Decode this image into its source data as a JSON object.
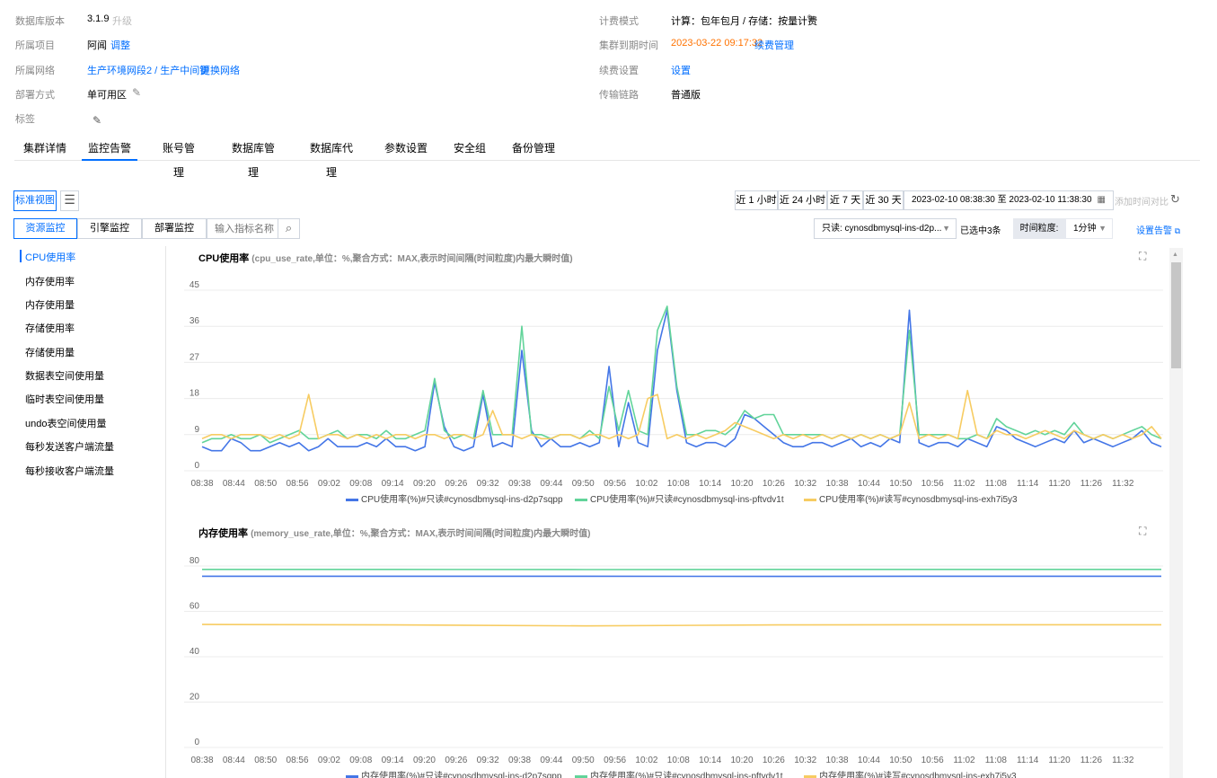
{
  "info": {
    "left": [
      {
        "label": "数据库版本",
        "value": "3.1.9",
        "action": "升级"
      },
      {
        "label": "所属项目",
        "value": "阿闻",
        "action": "调整"
      },
      {
        "label": "所属网络",
        "link": "生产环境网段2 / 生产中间键",
        "action": "更换网络"
      },
      {
        "label": "部署方式",
        "value": "单可用区"
      },
      {
        "label": "标签"
      }
    ],
    "right": [
      {
        "label": "计费模式",
        "value": "计算：包年包月 / 存储：按量计费"
      },
      {
        "label": "集群到期时间",
        "date": "2023-03-22 09:17:32",
        "action": "续费管理"
      },
      {
        "label": "续费设置",
        "action": "设置"
      },
      {
        "label": "传输链路",
        "value": "普通版"
      }
    ]
  },
  "tabs": [
    "集群详情",
    "监控告警",
    "账号管理",
    "数据库管理",
    "数据库代理",
    "参数设置",
    "安全组",
    "备份管理"
  ],
  "toolbar": {
    "view_button": "标准视图",
    "time_ranges": [
      "近 1 小时",
      "近 24 小时",
      "近 7 天",
      "近 30 天"
    ],
    "time_range_text": "2023-02-10 08:38:30 至 2023-02-10 11:38:30",
    "compare": "添加时间对比",
    "monitor_tabs": [
      "资源监控",
      "引擎监控",
      "部署监控"
    ],
    "search_placeholder": "输入指标名称",
    "instance_select": "只读: cynosdbmysql-ins-d2p...",
    "selected_count": "已选中3条",
    "granularity_label": "时间粒度:",
    "granularity_value": "1分钟",
    "alarm_link": "设置告警"
  },
  "sidebar": [
    "CPU使用率",
    "内存使用率",
    "内存使用量",
    "存储使用率",
    "存储使用量",
    "数据表空间使用量",
    "临时表空间使用量",
    "undo表空间使用量",
    "每秒发送客户端流量",
    "每秒接收客户端流量"
  ],
  "colors": {
    "blue": "#4476e7",
    "green": "#62d49a",
    "yellow": "#f7cc62",
    "accent": "#006eff"
  },
  "chart_data": [
    {
      "type": "line",
      "title": "CPU使用率",
      "subtitle": "(cpu_use_rate,单位：%,聚合方式：MAX,表示时间间隔(时间粒度)内最大瞬时值)",
      "ylim": [
        0,
        45
      ],
      "yticks": [
        "0",
        "9",
        "18",
        "27",
        "36",
        "45"
      ],
      "xticks": [
        "08:38",
        "08:44",
        "08:50",
        "08:56",
        "09:02",
        "09:08",
        "09:14",
        "09:20",
        "09:26",
        "09:32",
        "09:38",
        "09:44",
        "09:50",
        "09:56",
        "10:02",
        "10:08",
        "10:14",
        "10:20",
        "10:26",
        "10:32",
        "10:38",
        "10:44",
        "10:50",
        "10:56",
        "11:02",
        "11:08",
        "11:14",
        "11:20",
        "11:26",
        "11:32"
      ],
      "x_start": "08:38",
      "x_step_minutes": 6,
      "series": [
        {
          "name": "CPU使用率(%)#只读#cynosdbmysql-ins-d2p7sqpp",
          "color": "#4476e7",
          "values": [
            6,
            5,
            5,
            8,
            7,
            5,
            5,
            6,
            7,
            6,
            7,
            5,
            6,
            8,
            6,
            6,
            6,
            7,
            6,
            8,
            6,
            6,
            5,
            6,
            22,
            11,
            6,
            5,
            6,
            19,
            6,
            7,
            6,
            30,
            10,
            6,
            8,
            6,
            6,
            7,
            6,
            7,
            26,
            6,
            17,
            7,
            6,
            30,
            40,
            20,
            7,
            6,
            7,
            7,
            6,
            8,
            14,
            13,
            11,
            9,
            7,
            6,
            6,
            7,
            7,
            6,
            7,
            8,
            6,
            7,
            6,
            8,
            7,
            40,
            7,
            6,
            7,
            7,
            6,
            8,
            7,
            6,
            11,
            10,
            8,
            7,
            6,
            7,
            8,
            7,
            10,
            7,
            8,
            7,
            6,
            7,
            8,
            10,
            7,
            6
          ]
        },
        {
          "name": "CPU使用率(%)#只读#cynosdbmysql-ins-pftvdv1t",
          "color": "#62d49a",
          "values": [
            7,
            8,
            8,
            9,
            8,
            8,
            9,
            7,
            8,
            9,
            10,
            8,
            8,
            9,
            10,
            8,
            9,
            9,
            8,
            10,
            8,
            8,
            9,
            10,
            23,
            10,
            8,
            9,
            8,
            20,
            9,
            9,
            9,
            36,
            9,
            9,
            8,
            9,
            9,
            8,
            10,
            8,
            21,
            10,
            20,
            10,
            9,
            35,
            41,
            21,
            9,
            9,
            10,
            10,
            9,
            11,
            15,
            13,
            14,
            14,
            9,
            9,
            9,
            9,
            9,
            8,
            9,
            8,
            9,
            8,
            9,
            8,
            9,
            35,
            9,
            9,
            9,
            9,
            8,
            8,
            9,
            8,
            13,
            11,
            10,
            9,
            10,
            9,
            10,
            9,
            12,
            9,
            8,
            9,
            8,
            9,
            10,
            11,
            9,
            8
          ]
        },
        {
          "name": "CPU使用率(%)#读写#cynosdbmysql-ins-exh7i5y3",
          "color": "#f7cc62",
          "values": [
            8,
            9,
            9,
            8,
            9,
            9,
            9,
            8,
            9,
            8,
            9,
            19,
            8,
            9,
            9,
            8,
            9,
            8,
            9,
            8,
            9,
            9,
            8,
            9,
            9,
            8,
            9,
            9,
            8,
            9,
            15,
            9,
            9,
            8,
            9,
            8,
            8,
            9,
            9,
            8,
            9,
            9,
            8,
            9,
            8,
            9,
            18,
            19,
            8,
            9,
            8,
            9,
            8,
            9,
            10,
            12,
            11,
            10,
            9,
            8,
            9,
            8,
            9,
            8,
            9,
            8,
            9,
            8,
            9,
            8,
            9,
            8,
            9,
            17,
            8,
            9,
            8,
            9,
            8,
            20,
            9,
            8,
            10,
            9,
            9,
            8,
            9,
            10,
            9,
            8,
            10,
            9,
            8,
            9,
            8,
            9,
            8,
            9,
            11,
            8
          ]
        }
      ]
    },
    {
      "type": "line",
      "title": "内存使用率",
      "subtitle": "(memory_use_rate,单位：%,聚合方式：MAX,表示时间间隔(时间粒度)内最大瞬时值)",
      "ylim": [
        0,
        80
      ],
      "yticks": [
        "0",
        "20",
        "40",
        "60",
        "80"
      ],
      "xticks": [
        "08:38",
        "08:44",
        "08:50",
        "08:56",
        "09:02",
        "09:08",
        "09:14",
        "09:20",
        "09:26",
        "09:32",
        "09:38",
        "09:44",
        "09:50",
        "09:56",
        "10:02",
        "10:08",
        "10:14",
        "10:20",
        "10:26",
        "10:32",
        "10:38",
        "10:44",
        "10:50",
        "10:56",
        "11:02",
        "11:08",
        "11:14",
        "11:20",
        "11:26",
        "11:32"
      ],
      "x_start": "08:38",
      "x_step_minutes": 6,
      "series": [
        {
          "name": "内存使用率(%)#只读#cynosdbmysql-ins-d2p7sqpp",
          "color": "#4476e7",
          "values": [
            75.5,
            75.5,
            75.5,
            75.4,
            75.5,
            75.5
          ]
        },
        {
          "name": "内存使用率(%)#只读#cynosdbmysql-ins-pftvdv1t",
          "color": "#62d49a",
          "values": [
            78.5,
            78.5,
            78.4,
            78.5,
            78.5,
            78.5
          ]
        },
        {
          "name": "内存使用率(%)#读写#cynosdbmysql-ins-exh7i5y3",
          "color": "#f7cc62",
          "values": [
            54.2,
            54.0,
            53.6,
            54.0,
            54.1,
            54.1
          ]
        }
      ]
    }
  ]
}
